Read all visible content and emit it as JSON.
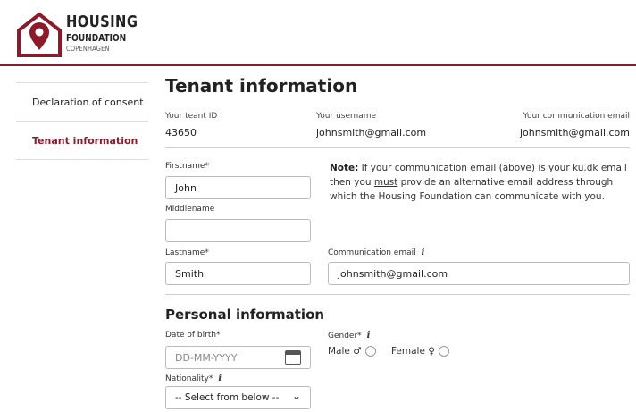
{
  "brand": {
    "line1": "HOUSING",
    "line2": "FOUNDATION",
    "line3": "COPENHAGEN",
    "color": "#8b1a2b"
  },
  "sidebar": {
    "items": [
      {
        "label": "Declaration of consent",
        "active": false
      },
      {
        "label": "Tenant information",
        "active": true
      }
    ]
  },
  "main": {
    "title": "Tenant information",
    "tenant_id_label": "Your teant ID",
    "tenant_id": "43650",
    "username_label": "Your username",
    "username": "johnsmith@gmail.com",
    "comm_email_label": "Your communication email",
    "comm_email": "johnsmith@gmail.com"
  },
  "form": {
    "firstname_label": "Firstname*",
    "firstname": "John",
    "middlename_label": "Middlename",
    "middlename": "",
    "lastname_label": "Lastname*",
    "lastname": "Smith",
    "note_strong": "Note:",
    "note_part1": " If your communication email (above) is your ku.dk email then you ",
    "note_must": "must",
    "note_part2": " provide an alternative email address through which the Housing Foundation can communicate with you.",
    "comm_email_label": "Communication email",
    "comm_email": "johnsmith@gmail.com",
    "info_glyph": "i"
  },
  "personal": {
    "heading": "Personal information",
    "dob_label": "Date of birth*",
    "dob_placeholder": "DD-MM-YYYY",
    "gender_label": "Gender*",
    "male_label": "Male ♂",
    "female_label": "Female ♀",
    "nationality_label": "Nationality*",
    "nationality_value": "-- Select from below --",
    "chevron": "⌄"
  }
}
